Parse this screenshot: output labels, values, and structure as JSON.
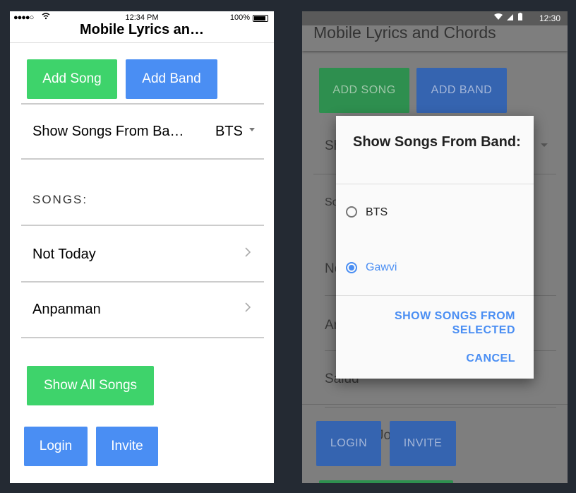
{
  "ios": {
    "status": {
      "signal": "●●●●○",
      "time": "12:34 PM",
      "battery": "100%"
    },
    "header_title": "Mobile Lyrics an…",
    "add_song_label": "Add Song",
    "add_band_label": "Add Band",
    "picker": {
      "label": "Show Songs From Ba…",
      "value": "BTS"
    },
    "songs_header": "SONGS:",
    "songs": [
      {
        "title": "Not Today"
      },
      {
        "title": "Anpanman"
      }
    ],
    "show_all_label": "Show All Songs",
    "login_label": "Login",
    "invite_label": "Invite"
  },
  "android": {
    "status": {
      "time": "12:30"
    },
    "appbar_title": "Mobile Lyrics and Chords",
    "add_song_label": "ADD SONG",
    "add_band_label": "ADD BAND",
    "bg_picker_text": "Sh",
    "bg_songs_header": "So",
    "bg_songs": [
      "No",
      "An",
      "Salud"
    ],
    "bg_partial": "Jo",
    "login_label": "LOGIN",
    "invite_label": "INVITE",
    "dialog": {
      "title": "Show Songs From Band:",
      "options": [
        {
          "label": "BTS",
          "selected": false
        },
        {
          "label": "Gawvi",
          "selected": true
        }
      ],
      "primary_action": "SHOW SONGS FROM SELECTED",
      "cancel_action": "CANCEL"
    }
  },
  "colors": {
    "green": "#3ed36b",
    "blue": "#4a8ef3",
    "background": "#242a33"
  }
}
